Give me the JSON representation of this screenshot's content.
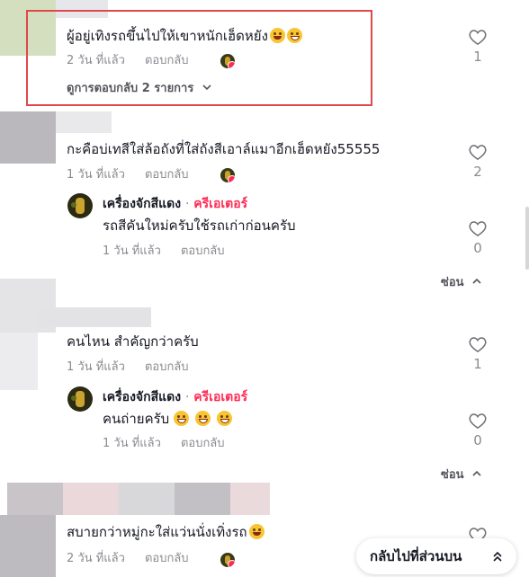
{
  "comments": [
    {
      "text": "ผู้อยู่เทิงรถขึ้นไปให้เขาหนักเฮ็ดหยัง",
      "time": "2 วัน ที่แล้ว",
      "reply": "ตอบกลับ",
      "likes": "1",
      "view_replies": "ดูการตอบกลับ 2 รายการ"
    },
    {
      "text": "กะคือบ่เทสีใส่ล้อถังที่ใส่ถังสีเอาล์แมาอีกเฮ็ดหยัง55555",
      "time": "1 วัน ที่แล้ว",
      "reply": "ตอบกลับ",
      "likes": "2",
      "creator_reply": {
        "author": "เครื่องจักสีแดง",
        "badge": "ครีเอเตอร์",
        "text": "รถสีคันใหม่ครับใช้รถเก่าก่อนครับ",
        "time": "1 วัน ที่แล้ว",
        "reply": "ตอบกลับ",
        "likes": "0"
      },
      "hide": "ซ่อน"
    },
    {
      "text": "คนไหน สำคัญกว่าครับ",
      "time": "1 วัน ที่แล้ว",
      "reply": "ตอบกลับ",
      "likes": "1",
      "creator_reply": {
        "author": "เครื่องจักสีแดง",
        "badge": "ครีเอเตอร์",
        "text": "คนถ่ายครับ",
        "time": "1 วัน ที่แล้ว",
        "reply": "ตอบกลับ",
        "likes": "0"
      },
      "hide": "ซ่อน"
    },
    {
      "text": "สบายกว่าหมู่กะใส่แว่นนั่งเทิ่งรถ",
      "time": "2 วัน ที่แล้ว",
      "reply": "ตอบกลับ"
    }
  ],
  "separator": "·",
  "back_to_top": "กลับไปที่ส่วนบน",
  "icons": {
    "like": "heart-outline-icon",
    "chevron": "chevron-down-icon",
    "chevron_up": "chevron-up-icon",
    "double_up": "double-chevron-up-icon"
  },
  "colors": {
    "creator": "#fe2c55",
    "highlight": "#e0484c",
    "muted": "#8a8b91"
  }
}
